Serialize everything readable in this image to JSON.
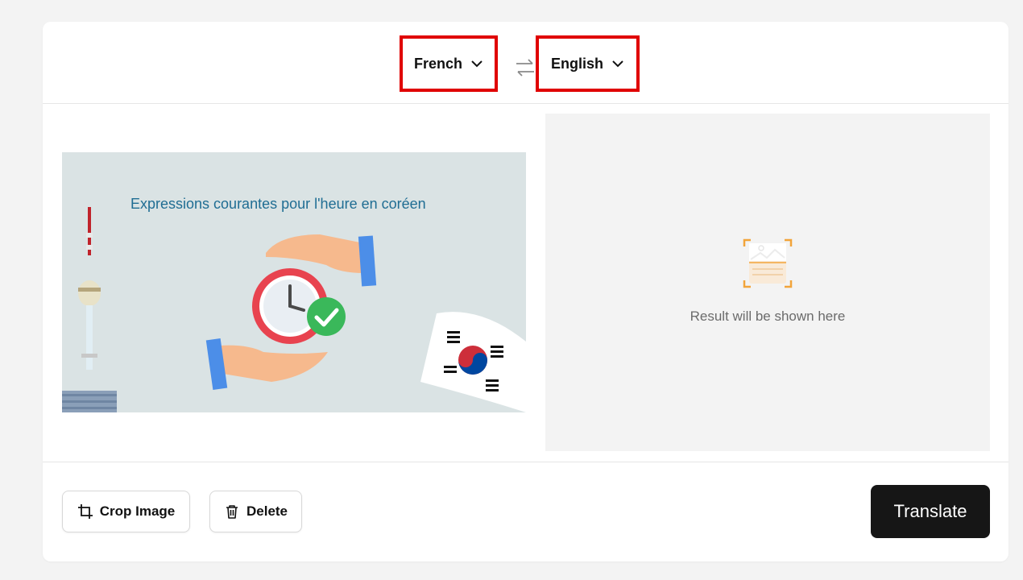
{
  "languages": {
    "source": "French",
    "target": "English"
  },
  "icons": {
    "source_chevron": "chevron-down-icon",
    "target_chevron": "chevron-down-icon",
    "swap": "swap-arrows-icon",
    "result_placeholder": "image-placeholder-icon",
    "crop": "crop-icon",
    "delete": "trash-icon"
  },
  "preview": {
    "caption": "Expressions courantes pour l'heure en coréen"
  },
  "result": {
    "placeholder_text": "Result will be shown here"
  },
  "footer": {
    "crop_label": "Crop Image",
    "delete_label": "Delete",
    "translate_label": "Translate"
  },
  "colors": {
    "highlight_border": "#e00000",
    "translate_bg": "#161616",
    "result_panel_bg": "#f3f3f3",
    "placeholder_accent": "#f2a43a"
  }
}
